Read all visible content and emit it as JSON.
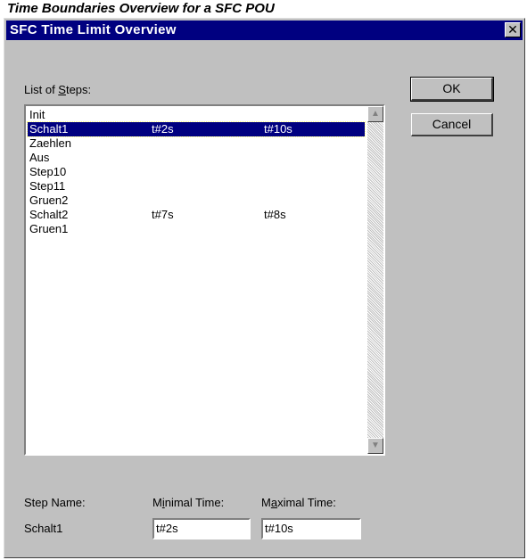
{
  "caption": "Time Boundaries Overview for a SFC POU",
  "dialog": {
    "title": "SFC Time Limit Overview",
    "close_glyph": "✕",
    "list_label_pre": "List of ",
    "list_label_accel": "S",
    "list_label_post": "teps:",
    "steps": [
      {
        "name": "Init",
        "min": "",
        "max": ""
      },
      {
        "name": "Schalt1",
        "min": "t#2s",
        "max": "t#10s"
      },
      {
        "name": "Zaehlen",
        "min": "",
        "max": ""
      },
      {
        "name": "Aus",
        "min": "",
        "max": ""
      },
      {
        "name": "Step10",
        "min": "",
        "max": ""
      },
      {
        "name": "Step11",
        "min": "",
        "max": ""
      },
      {
        "name": "Gruen2",
        "min": "",
        "max": ""
      },
      {
        "name": "Schalt2",
        "min": "t#7s",
        "max": "t#8s"
      },
      {
        "name": "Gruen1",
        "min": "",
        "max": ""
      }
    ],
    "selected_index": 1,
    "scroll_up_icon": "▲",
    "scroll_down_icon": "▼",
    "ok_label": "OK",
    "cancel_label": "Cancel",
    "step_name_label": "Step Name:",
    "min_label_pre": "M",
    "min_label_accel": "i",
    "min_label_post": "nimal Time:",
    "max_label_pre": "M",
    "max_label_accel": "a",
    "max_label_post": "ximal Time:",
    "step_name_value": "Schalt1",
    "min_value": "t#2s",
    "max_value": "t#10s"
  }
}
